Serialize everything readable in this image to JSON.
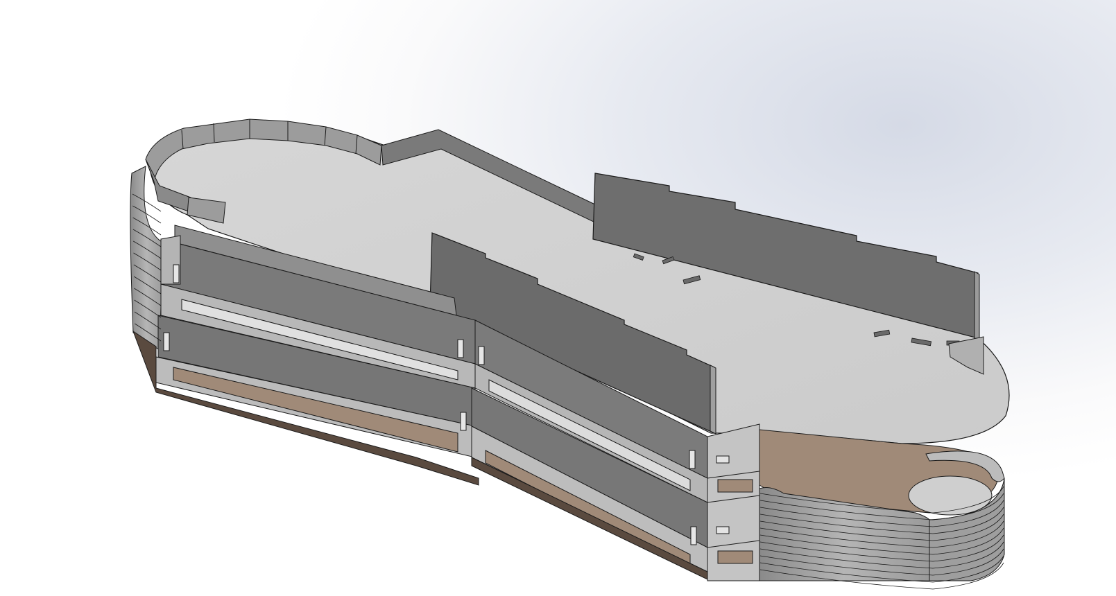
{
  "viewport": {
    "background_top_right": "#d5dae6",
    "background_base": "#ffffff"
  },
  "model": {
    "name_icon": "3d-assembly-model",
    "palette": {
      "top_face": "#d2d2d2",
      "light_face": "#bdbdbd",
      "mid_face": "#a9a9a9",
      "side_face": "#8c8c8c",
      "dark_face": "#707070",
      "edge": "#1a1a1a",
      "base_layer": "#a08a78",
      "base_shadow": "#5a4a3f"
    },
    "wall_band_count": 12
  }
}
